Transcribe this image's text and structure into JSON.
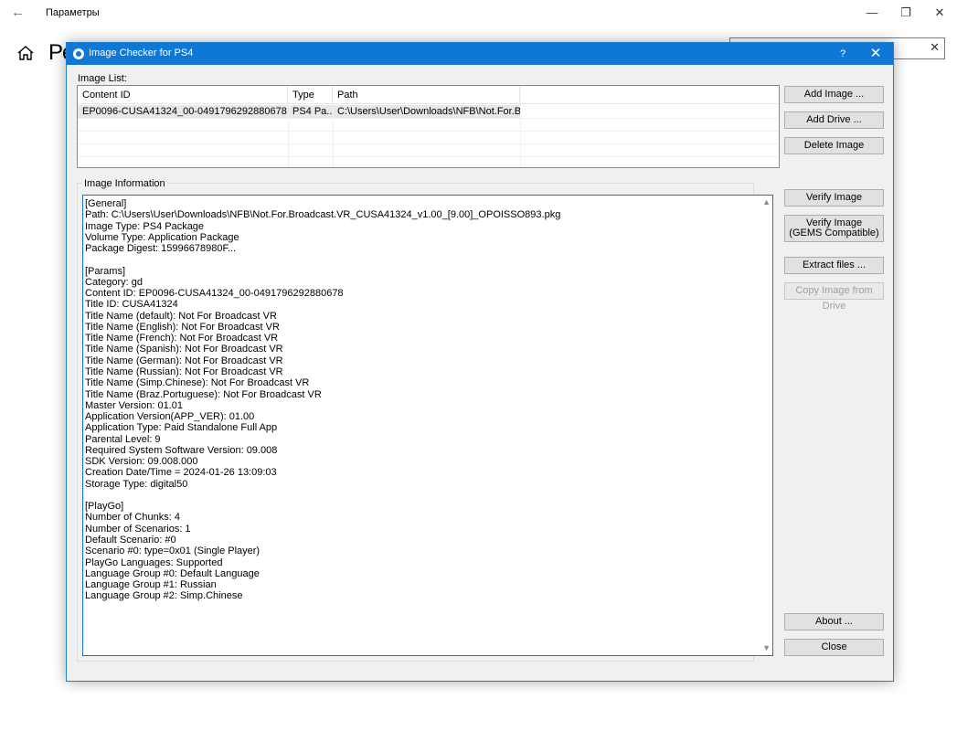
{
  "background_window": {
    "title": "Параметры",
    "heading_fragment": "Ре"
  },
  "dialog": {
    "title": "Image Checker for PS4",
    "help_label": "?",
    "image_list_label": "Image List:",
    "columns": [
      "Content ID",
      "Type",
      "Path"
    ],
    "rows": [
      {
        "content_id": "EP0096-CUSA41324_00-0491796292880678",
        "type": "PS4 Pa...",
        "path": "C:\\Users\\User\\Downloads\\NFB\\Not.For.Broad..."
      }
    ],
    "info_label": "Image Information",
    "info_lines": [
      "[General]",
      "Path: C:\\Users\\User\\Downloads\\NFB\\Not.For.Broadcast.VR_CUSA41324_v1.00_[9.00]_OPOISSO893.pkg",
      "Image Type: PS4 Package",
      "Volume Type: Application Package",
      "Package Digest: 15996678980F...",
      "",
      "[Params]",
      "Category: gd",
      "Content ID: EP0096-CUSA41324_00-0491796292880678",
      "Title ID: CUSA41324",
      "Title Name (default): Not For Broadcast VR",
      "Title Name (English): Not For Broadcast VR",
      "Title Name (French): Not For Broadcast VR",
      "Title Name (Spanish): Not For Broadcast VR",
      "Title Name (German): Not For Broadcast VR",
      "Title Name (Russian): Not For Broadcast VR",
      "Title Name (Simp.Chinese): Not For Broadcast VR",
      "Title Name (Braz.Portuguese): Not For Broadcast VR",
      "Master Version: 01.01",
      "Application Version(APP_VER): 01.00",
      "Application Type: Paid Standalone Full App",
      "Parental Level: 9",
      "Required System Software Version: 09.008",
      "SDK Version: 09.008.000",
      "Creation Date/Time = 2024-01-26 13:09:03",
      "Storage Type: digital50",
      "",
      "[PlayGo]",
      "Number of Chunks: 4",
      "Number of Scenarios: 1",
      "Default Scenario: #0",
      "Scenario #0: type=0x01 (Single Player)",
      "PlayGo Languages: Supported",
      "Language Group #0: Default Language",
      "Language Group #1: Russian",
      "Language Group #2: Simp.Chinese"
    ],
    "buttons": {
      "add_image": "Add Image ...",
      "add_drive": "Add Drive ...",
      "delete_image": "Delete Image",
      "verify_image": "Verify Image",
      "verify_gems_line1": "Verify Image",
      "verify_gems_line2": "(GEMS Compatible)",
      "extract_files": "Extract files ...",
      "copy_from_drive": "Copy Image from Drive",
      "about": "About ...",
      "close": "Close"
    }
  }
}
